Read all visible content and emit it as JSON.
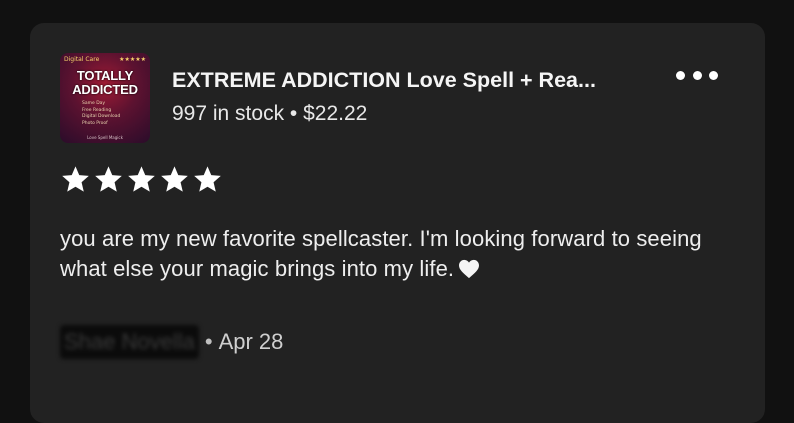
{
  "product": {
    "thumbnail": {
      "badge": "Digital Care",
      "badge_stars": "★★★★★",
      "title": "TOTALLY ADDICTED",
      "lines": [
        "Same Day",
        "Free Reading",
        "Digital Download",
        "Photo Proof"
      ],
      "footer": "Love Spell Magick"
    },
    "title": "EXTREME ADDICTION Love Spell + Rea...",
    "stock": "997 in stock",
    "separator": "•",
    "price": "$22.22"
  },
  "menu": {
    "icon": "more-horizontal-icon"
  },
  "review": {
    "rating": 5,
    "rating_max": 5,
    "text": "you are my new favorite spellcaster. I'm looking forward to seeing what else your magic brings into my life.",
    "emoji": "white-heart-icon",
    "author": "Shae Novella",
    "date": "Apr 28",
    "date_separator": "•"
  },
  "colors": {
    "background": "#111111",
    "card": "#222222",
    "text": "#f2f2f2",
    "star": "#ffffff"
  }
}
